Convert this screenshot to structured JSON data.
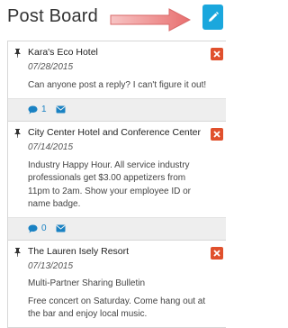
{
  "header": {
    "title": "Post Board"
  },
  "posts": [
    {
      "title": "Kara's Eco Hotel",
      "date": "07/28/2015",
      "text": "Can anyone post a reply? I can't figure it out!",
      "comment_count": "1"
    },
    {
      "title": "City Center Hotel and Conference Center",
      "date": "07/14/2015",
      "text": "Industry Happy Hour. All service industry professionals get $3.00 appetizers from 11pm to 2am. Show your employee ID or name badge.",
      "comment_count": "0"
    },
    {
      "title": "The Lauren Isely Resort",
      "date": "07/13/2015",
      "subtitle": "Multi-Partner Sharing Bulletin",
      "text": "Free concert on Saturday. Come hang out at the bar and enjoy local music."
    }
  ],
  "colors": {
    "accent": "#1aa7dd",
    "delete": "#e0502d",
    "link": "#1a82c3",
    "arrow": "#f08a8a"
  },
  "icons": {
    "edit": "pencil-icon",
    "pin": "pushpin-icon",
    "delete": "close-icon",
    "comment": "comment-icon",
    "email": "envelope-icon"
  }
}
